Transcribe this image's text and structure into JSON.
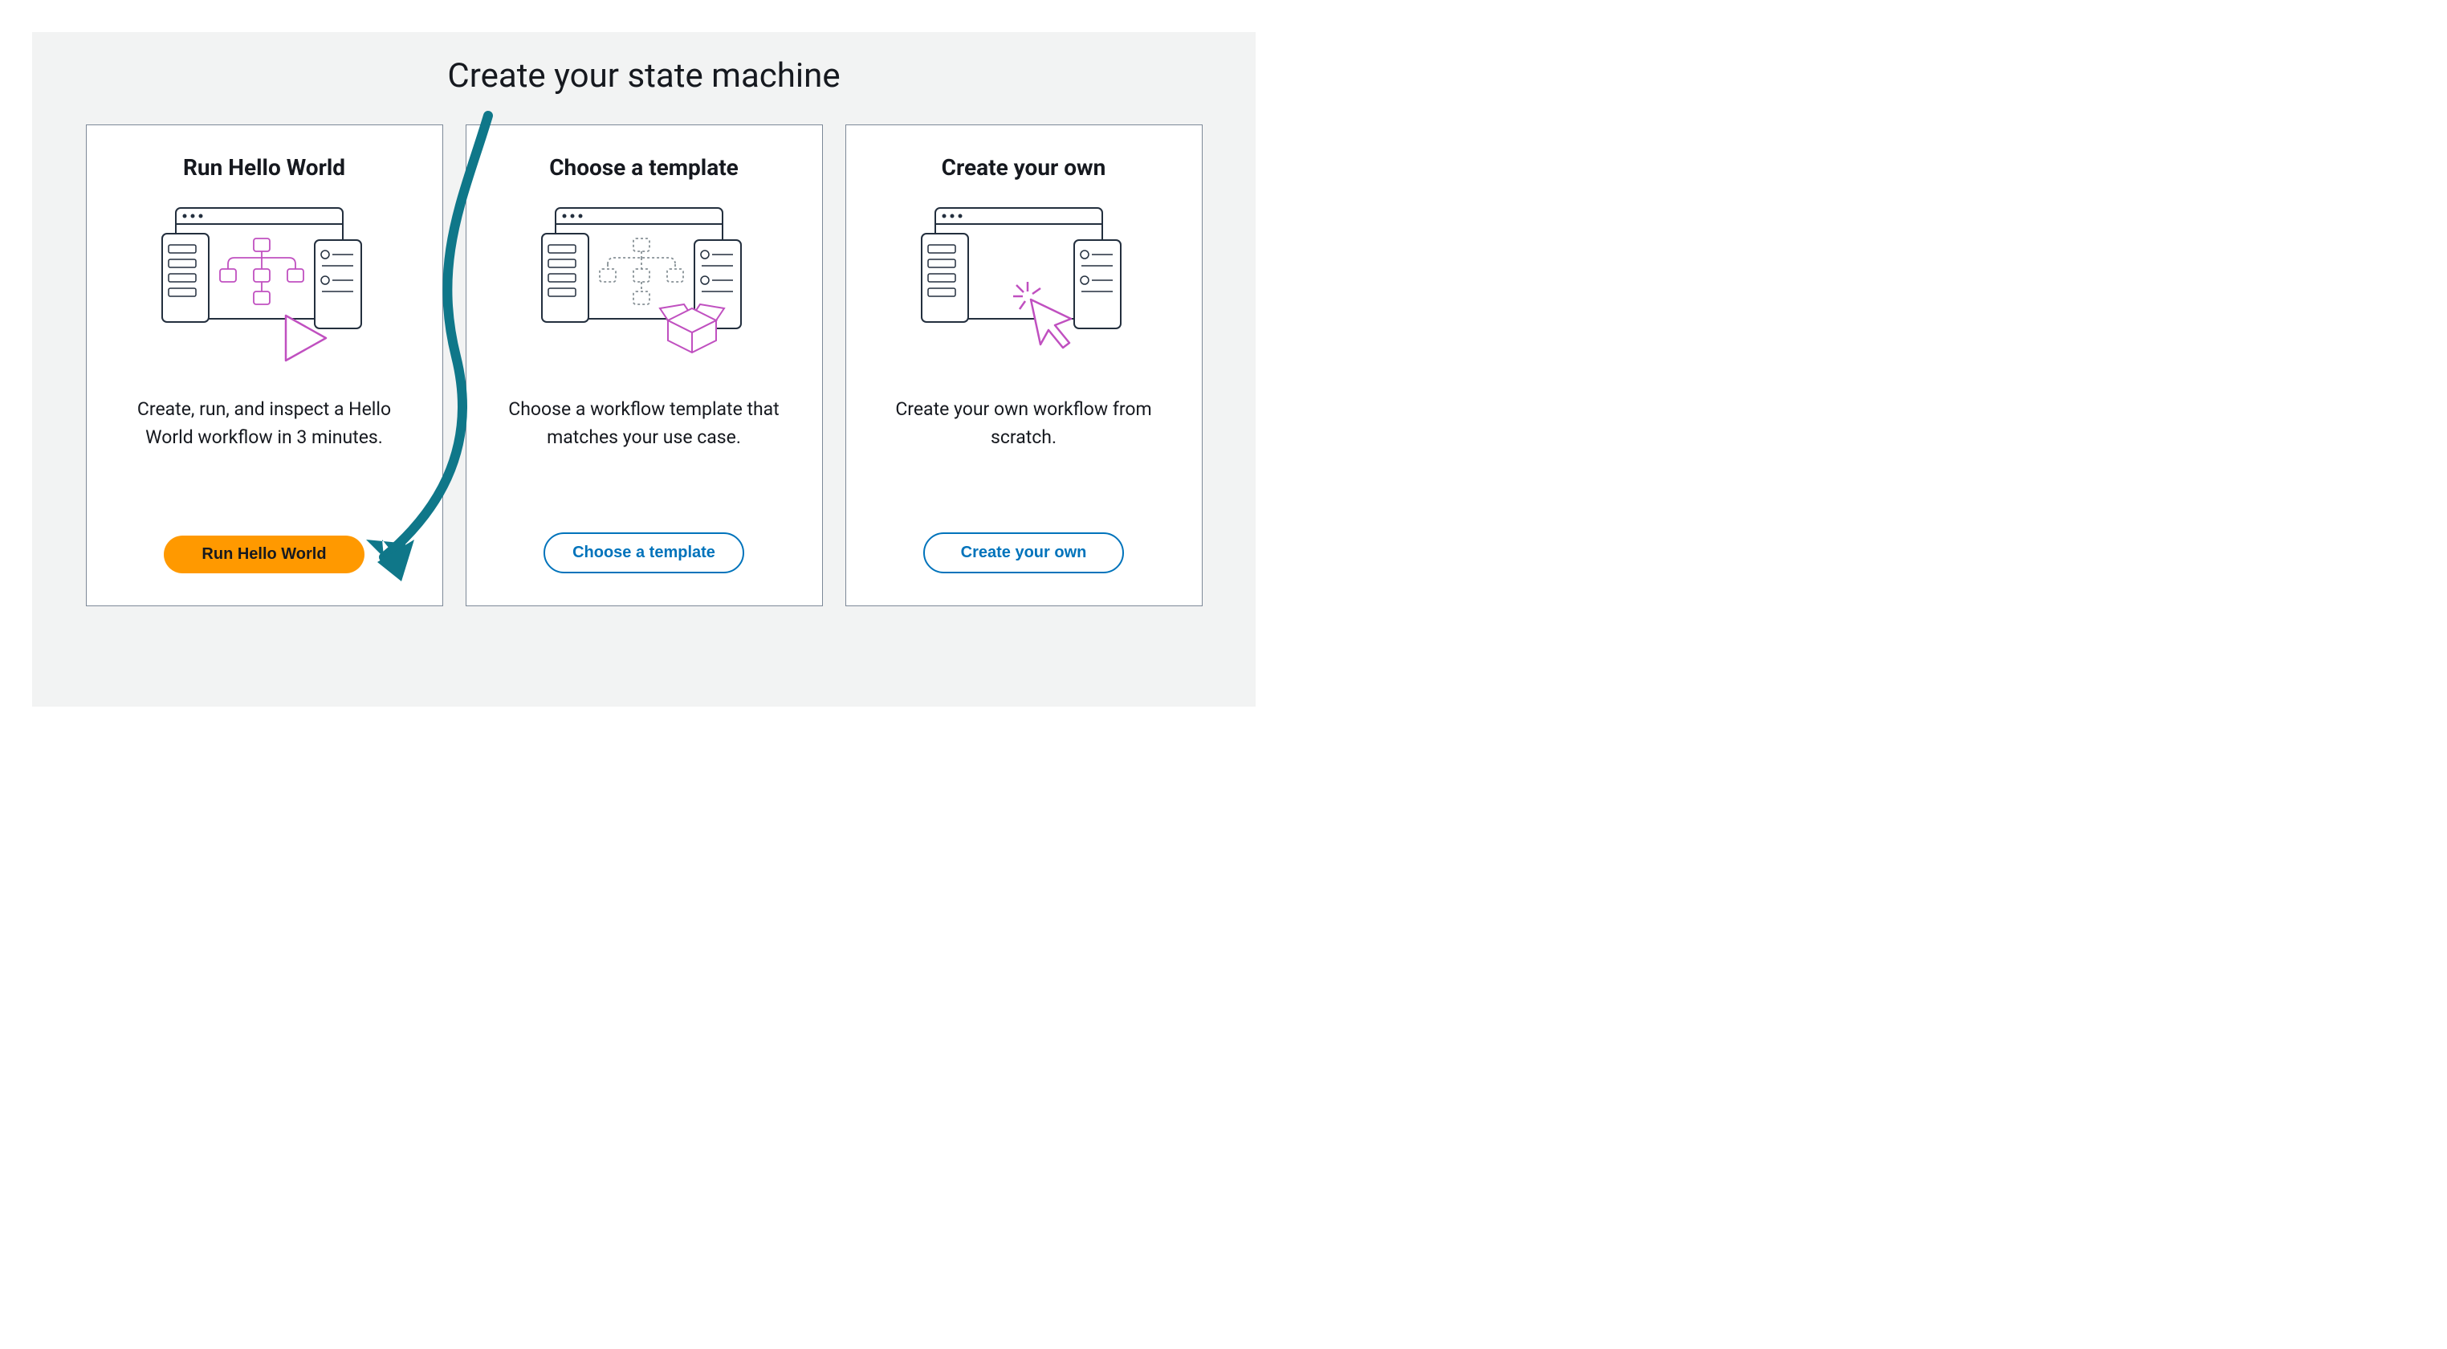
{
  "page": {
    "title": "Create your state machine"
  },
  "cards": [
    {
      "title": "Run Hello World",
      "description": "Create, run, and inspect a Hello World workflow in 3 minutes.",
      "button_label": "Run Hello World",
      "button_style": "primary"
    },
    {
      "title": "Choose a template",
      "description": "Choose a workflow template that matches your use case.",
      "button_label": "Choose a template",
      "button_style": "secondary"
    },
    {
      "title": "Create your own",
      "description": "Create your own workflow from scratch.",
      "button_label": "Create your own",
      "button_style": "secondary"
    }
  ],
  "annotation": {
    "arrow_color": "#0f7789"
  }
}
